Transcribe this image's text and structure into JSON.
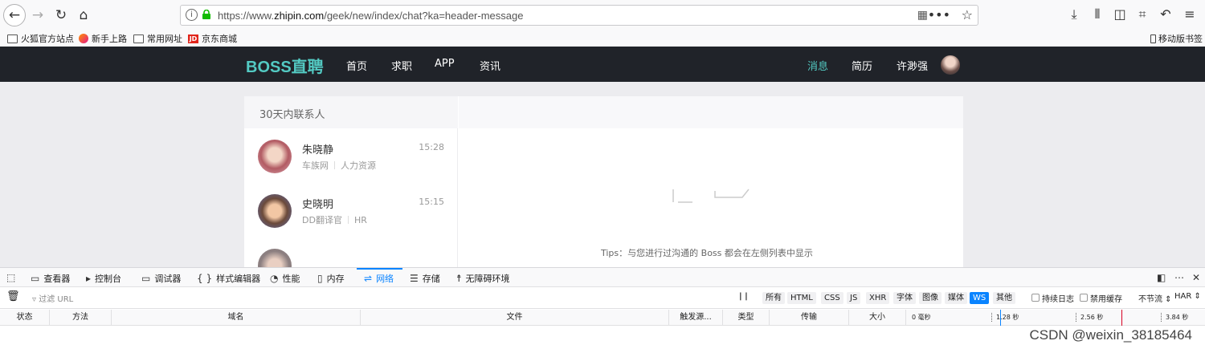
{
  "browser": {
    "url_prefix": "https://www.",
    "url_domain": "zhipin.com",
    "url_path": "/geek/new/index/chat?ka=header-message",
    "url_menu_glyph": "•••"
  },
  "bookmarks": {
    "items": [
      "火狐官方站点",
      "新手上路",
      "常用网址",
      "京东商城"
    ],
    "jd_logo": "JD",
    "mobile": "移动版书签"
  },
  "site": {
    "logo": "BOSS直聘",
    "nav_left": [
      "首页",
      "求职",
      "APP",
      "资讯"
    ],
    "nav_right": [
      "消息",
      "简历",
      "许渺强"
    ],
    "accent": "#53cac3"
  },
  "chat": {
    "list_title": "30天内联系人",
    "contacts": [
      {
        "name": "朱晓静",
        "time": "15:28",
        "company": "车族网",
        "role": "人力资源"
      },
      {
        "name": "史晓明",
        "time": "15:15",
        "company": "DD翻译官",
        "role": "HR"
      }
    ],
    "tips": "Tips：与您进行过沟通的 Boss 都会在左侧列表中显示"
  },
  "devtools": {
    "tabs": [
      "查看器",
      "控制台",
      "调试器",
      "样式编辑器",
      "性能",
      "内存",
      "网络",
      "存储",
      "无障碍环境"
    ],
    "tab_glyphs": [
      "{ }"
    ],
    "active_tab": "网络",
    "filter_placeholder": "过滤 URL",
    "pause_glyph": "| |",
    "type_filters": [
      "所有",
      "HTML",
      "CSS",
      "JS",
      "XHR",
      "字体",
      "图像",
      "媒体",
      "WS",
      "其他"
    ],
    "selected_filter": "WS",
    "persist_log": "持续日志",
    "disable_cache": "禁用缓存",
    "throttle": "不节流 ⇕",
    "har": "HAR ⇕",
    "columns": [
      "状态",
      "方法",
      "域名",
      "文件",
      "触发源...",
      "类型",
      "传输",
      "大小"
    ],
    "timeline_ticks": [
      "0 毫秒",
      "1.28 秒",
      "2.56 秒",
      "3.84 秒"
    ],
    "accent": "#0a84ff"
  },
  "watermark": "CSDN @weixin_38185464"
}
